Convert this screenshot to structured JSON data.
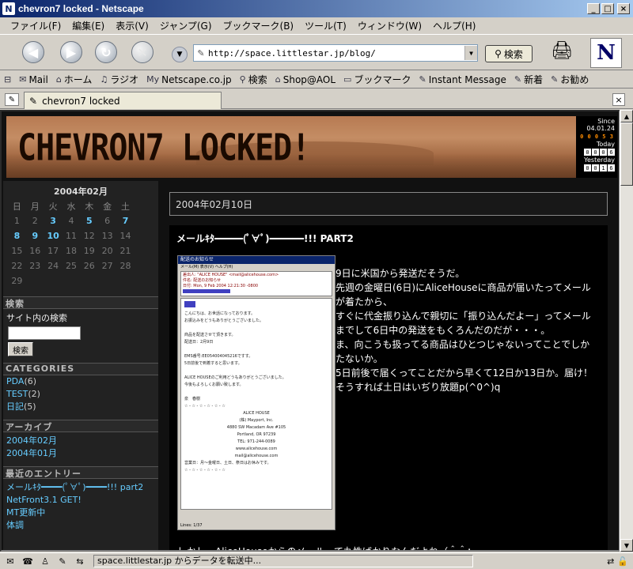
{
  "window": {
    "title": "chevron7 locked - Netscape",
    "app_icon": "N",
    "minimize": "_",
    "maximize": "□",
    "close": "×"
  },
  "menu": [
    "ファイル(F)",
    "編集(E)",
    "表示(V)",
    "ジャンプ(G)",
    "ブックマーク(B)",
    "ツール(T)",
    "ウィンドウ(W)",
    "ヘルプ(H)"
  ],
  "navigation": {
    "url": "http://space.littlestar.jp/blog/",
    "search_label": "検索",
    "logo": "N"
  },
  "personal_toolbar": [
    {
      "icon": "mail-icon",
      "glyph": "✉",
      "label": "Mail"
    },
    {
      "icon": "home-icon",
      "glyph": "⌂",
      "label": "ホーム"
    },
    {
      "icon": "radio-icon",
      "glyph": "♫",
      "label": "ラジオ"
    },
    {
      "icon": "netscape-icon",
      "glyph": "My",
      "label": "Netscape.co.jp"
    },
    {
      "icon": "search-icon",
      "glyph": "⚲",
      "label": "検索"
    },
    {
      "icon": "aol-icon",
      "glyph": "⌂",
      "label": "Shop@AOL"
    },
    {
      "icon": "folder-icon",
      "glyph": "▭",
      "label": "ブックマーク"
    },
    {
      "icon": "message-icon",
      "glyph": "✎",
      "label": "Instant Message"
    },
    {
      "icon": "bookmark-icon",
      "glyph": "✎",
      "label": "新着"
    },
    {
      "icon": "bookmark-icon",
      "glyph": "✎",
      "label": "お勧め"
    }
  ],
  "tab": {
    "label": "chevron7 locked",
    "close": "×"
  },
  "blog": {
    "title": "CHEVRON7 LOCKED!",
    "counter": {
      "since_label": "Since",
      "since_date": "04.01.24",
      "total": [
        "0",
        "0",
        "0",
        "5",
        "3"
      ],
      "today_label": "Today",
      "today": [
        "0",
        "0",
        "0",
        "6"
      ],
      "yesterday_label": "Yesterday",
      "yesterday": [
        "0",
        "0",
        "1",
        "6"
      ]
    },
    "calendar": {
      "title": "2004年02月",
      "weekdays": [
        "日",
        "月",
        "火",
        "水",
        "木",
        "金",
        "土"
      ],
      "rows": [
        [
          "1",
          "2",
          "3",
          "4",
          "5",
          "6",
          "7"
        ],
        [
          "8",
          "9",
          "10",
          "11",
          "12",
          "13",
          "14"
        ],
        [
          "15",
          "16",
          "17",
          "18",
          "19",
          "20",
          "21"
        ],
        [
          "22",
          "23",
          "24",
          "25",
          "26",
          "27",
          "28"
        ],
        [
          "29",
          "",
          "",
          "",
          "",
          "",
          ""
        ]
      ],
      "linked": [
        "3",
        "5",
        "7",
        "8",
        "9",
        "10"
      ]
    },
    "search": {
      "heading": "検索",
      "label": "サイト内の検索",
      "button": "検索"
    },
    "categories": {
      "heading": "CATEGORIES",
      "items": [
        {
          "name": "PDA",
          "count": "(6)"
        },
        {
          "name": "TEST",
          "count": "(2)"
        },
        {
          "name": "日記",
          "count": "(5)"
        }
      ]
    },
    "archives": {
      "heading": "アーカイブ",
      "items": [
        "2004年02月",
        "2004年01月"
      ]
    },
    "recent": {
      "heading": "最近のエントリー",
      "items": [
        "メールｷﾀ━━━━(ﾟ∀ﾟ)━━━━!!! part2",
        "NetFront3.1 GET!",
        "MT更新中",
        "体調"
      ]
    },
    "post": {
      "date": "2004年02月10日",
      "title": "メールｷﾀ━━━━━(ﾟ∀ﾟ)━━━━━━!!! PART2",
      "paragraphs": [
        "9日に米国から発送だそうだ。",
        "先週の金曜日(6日)にAliceHouseに商品が届いたってメールが着たから、",
        "すぐに代金振り込んで親切に「振り込んだよー」ってメールまでして6日中の発送をもくろんだのだが・・・。",
        "ま、向こうも扱ってる商品はひとつじゃないってことでしかたないか。",
        "5日前後で届くってことだから早くて12日か13日か。届け！そうすれば土日はいぢり放題p(^0^)q"
      ],
      "more": "しかし、AliceHouseからのメールって丸性ばかりなんだよね（＾＾；"
    },
    "email_shot": {
      "window_title": "配送のお知らせ",
      "menu": "メール(M)  表示(V)  ヘルプ(H)",
      "head_lines": [
        "差出人: \"ALICE HOUSE\" <mail@alicehouse.com>",
        "件名: 配送のお知らせ",
        "日付: Mon, 9 Feb 2004 12:21:30 -0800"
      ],
      "body_lines": [
        "こんにちは、お世話になっております。",
        "お振込みをどうもありがとうございました。",
        "",
        "商品を配送させて頂きます。",
        "配送日：2月9日",
        "",
        "EMS番号:EE054004045216ですす。",
        "5日前後で到着すると思います。",
        "",
        "ALICE HOUSEのご利用どうもありがとうございました。",
        "今後もよろしくお願い致します。",
        "",
        "泉　春樹",
        "☆ - ☆ - ☆ - ☆ - ☆ - ☆",
        "ALICE HOUSE",
        "(株) Mayport, Inc.",
        "4880 SW Macadam Ave #105",
        "Portland, OR 97239",
        "TEL: 971-244-0089",
        "www.alicehouse.com",
        "mail@alicehouse.com",
        "営業日：月～金曜日、土日、祭日はお休みです。",
        "☆ - ☆ - ☆ - ☆ - ☆ - ☆"
      ],
      "footer": "Lines: 1/37"
    }
  },
  "status": {
    "text": "space.littlestar.jp からデータを転送中..."
  }
}
